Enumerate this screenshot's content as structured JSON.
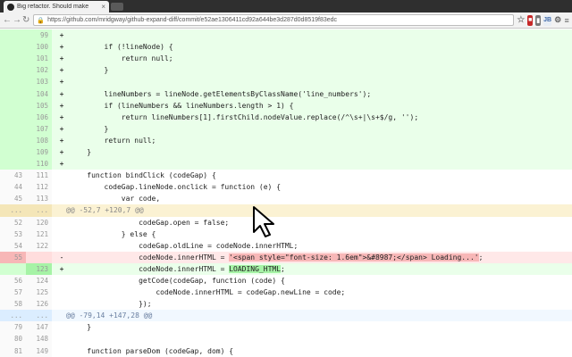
{
  "browser": {
    "tab_title": "Big refactor. Should make",
    "tab_close": "×",
    "url": "https://github.com/mridgway/github-expand-diff/commit/e52ae1306411cd92a644be3d287d0d8519f83edc",
    "lock": "🔒",
    "nav_back": "←",
    "nav_forward": "→",
    "nav_reload": "↻",
    "ext_star": "☆",
    "ext_red": "■",
    "ext_gray": "▮",
    "ext_jb": "JB",
    "ext_gear": "⚙",
    "ext_menu": "≡"
  },
  "colors": {
    "add_bg": "#eaffea",
    "del_bg": "#ffe8e8",
    "hunk_yellow": "#fbf2d3",
    "hunk_blue": "#f1f8ff"
  },
  "diff": {
    "rows": [
      {
        "type": "add",
        "old": "",
        "new": "99",
        "sign": "+",
        "code": ""
      },
      {
        "type": "add",
        "old": "",
        "new": "100",
        "sign": "+",
        "code": "        if (!lineNode) {"
      },
      {
        "type": "add",
        "old": "",
        "new": "101",
        "sign": "+",
        "code": "            return null;"
      },
      {
        "type": "add",
        "old": "",
        "new": "102",
        "sign": "+",
        "code": "        }"
      },
      {
        "type": "add",
        "old": "",
        "new": "103",
        "sign": "+",
        "code": ""
      },
      {
        "type": "add",
        "old": "",
        "new": "104",
        "sign": "+",
        "code": "        lineNumbers = lineNode.getElementsByClassName('line_numbers');"
      },
      {
        "type": "add",
        "old": "",
        "new": "105",
        "sign": "+",
        "code": "        if (lineNumbers && lineNumbers.length > 1) {"
      },
      {
        "type": "add",
        "old": "",
        "new": "106",
        "sign": "+",
        "code": "            return lineNumbers[1].firstChild.nodeValue.replace(/^\\s+|\\s+$/g, '');"
      },
      {
        "type": "add",
        "old": "",
        "new": "107",
        "sign": "+",
        "code": "        }"
      },
      {
        "type": "add",
        "old": "",
        "new": "108",
        "sign": "+",
        "code": "        return null;"
      },
      {
        "type": "add",
        "old": "",
        "new": "109",
        "sign": "+",
        "code": "    }"
      },
      {
        "type": "add",
        "old": "",
        "new": "110",
        "sign": "+",
        "code": ""
      },
      {
        "type": "ctx",
        "old": "43",
        "new": "111",
        "sign": "",
        "code": "    function bindClick (codeGap) {"
      },
      {
        "type": "ctx",
        "old": "44",
        "new": "112",
        "sign": "",
        "code": "        codeGap.lineNode.onclick = function (e) {"
      },
      {
        "type": "ctx",
        "old": "45",
        "new": "113",
        "sign": "",
        "code": "            var code,"
      },
      {
        "type": "hunk-yellow",
        "old": "...",
        "new": "...",
        "sign": "",
        "code": "@@ -52,7 +120,7 @@"
      },
      {
        "type": "ctx",
        "old": "52",
        "new": "120",
        "sign": "",
        "code": "                codeGap.open = false;"
      },
      {
        "type": "ctx",
        "old": "53",
        "new": "121",
        "sign": "",
        "code": "            } else {"
      },
      {
        "type": "ctx",
        "old": "54",
        "new": "122",
        "sign": "",
        "code": "                codeGap.oldLine = codeNode.innerHTML;"
      },
      {
        "type": "del",
        "old": "55",
        "new": "",
        "sign": "-",
        "code_pre": "                codeNode.innerHTML = ",
        "code_hl": "'<span style=\"font-size: 1.6em\">&#8987;</span> Loading...'",
        "code_post": ";"
      },
      {
        "type": "add-hl",
        "old": "",
        "new": "123",
        "sign": "+",
        "code_pre": "                codeNode.innerHTML = ",
        "code_hl": "LOADING_HTML",
        "code_post": ";"
      },
      {
        "type": "ctx",
        "old": "56",
        "new": "124",
        "sign": "",
        "code": "                getCode(codeGap, function (code) {"
      },
      {
        "type": "ctx",
        "old": "57",
        "new": "125",
        "sign": "",
        "code": "                    codeNode.innerHTML = codeGap.newLine = code;"
      },
      {
        "type": "ctx",
        "old": "58",
        "new": "126",
        "sign": "",
        "code": "                });"
      },
      {
        "type": "hunk-blue",
        "old": "...",
        "new": "...",
        "sign": "",
        "code": "@@ -79,14 +147,28 @@"
      },
      {
        "type": "ctx",
        "old": "79",
        "new": "147",
        "sign": "",
        "code": "    }"
      },
      {
        "type": "ctx",
        "old": "80",
        "new": "148",
        "sign": "",
        "code": ""
      },
      {
        "type": "ctx",
        "old": "81",
        "new": "149",
        "sign": "",
        "code": "    function parseDom (codeGap, dom) {"
      }
    ]
  }
}
